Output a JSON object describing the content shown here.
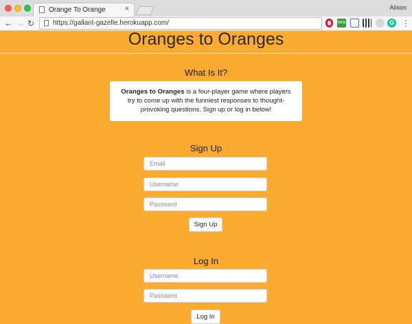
{
  "browser": {
    "tab_title": "Orange To Orange",
    "tab_close": "×",
    "user_name": "Alison",
    "url": "https://gallant-gazelle.herokuapp.com/",
    "extensions": [
      "opera-icon",
      "beta-icon",
      "cast-icon",
      "qr-code-icon",
      "extension-icon",
      "grammarly-icon"
    ],
    "beta_label": "beta",
    "grammarly_label": "G",
    "menu_label": "⋮"
  },
  "page": {
    "title": "Oranges to Oranges",
    "background_color": "#fbab2f",
    "about": {
      "heading": "What Is It?",
      "bold_name": "Oranges to Oranges",
      "description": " is a four-player game where players try to come up with the funniest responses to thought-provoking questions. Sign up or log in below!"
    },
    "signup": {
      "heading": "Sign Up",
      "email_placeholder": "Email",
      "username_placeholder": "Username",
      "password_placeholder": "Password",
      "button_label": "Sign Up"
    },
    "login": {
      "heading": "Log In",
      "username_placeholder": "Username",
      "password_placeholder": "Password",
      "button_label": "Log In"
    }
  }
}
